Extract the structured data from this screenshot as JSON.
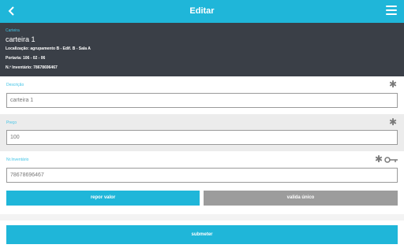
{
  "header": {
    "title": "Editar",
    "back_icon": "chevron-left-icon",
    "menu_icon": "hamburger-menu-icon"
  },
  "info": {
    "label": "Carteira",
    "name": "carteira 1",
    "location": "Localização: agrupamento B - Edif. B - Sala A",
    "porteria": "Portaria: 106 - 02 - 06",
    "inventory": "N.º Inventário: 78678696467"
  },
  "fields": {
    "descricao": {
      "label": "Descrição",
      "value": "carteira 1"
    },
    "preco": {
      "label": "Preço",
      "value": "100"
    },
    "inventario": {
      "label": "Nr.Inventário",
      "value": "78678696467"
    }
  },
  "buttons": {
    "repor": "repor valor",
    "valida": "valida único",
    "submeter": "submeter"
  },
  "colors": {
    "accent": "#1fb6d9",
    "panel": "#3a3f47"
  }
}
